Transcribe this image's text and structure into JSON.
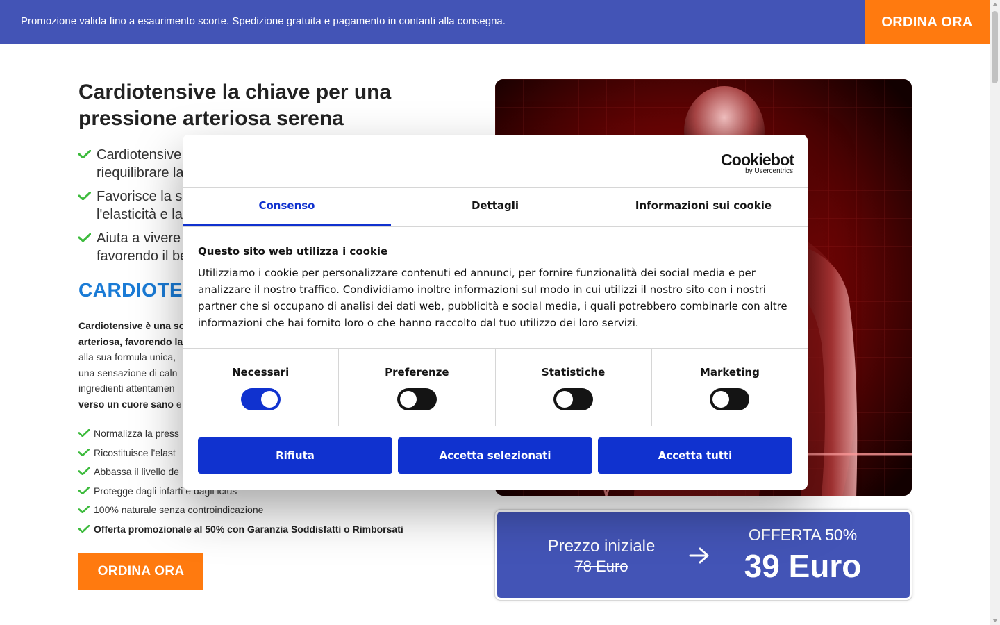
{
  "topbar": {
    "text": "Promozione valida fino a esaurimento scorte. Spedizione gratuita e pagamento in contanti alla consegna.",
    "cta": "ORDINA ORA"
  },
  "hero": {
    "title": "Cardiotensive la chiave per una pressione arteriosa serena",
    "bullets": [
      "Cardiotensive",
      "riequilibrare la",
      "Favorisce la sa",
      "l'elasticità e la",
      "Aiuta a vivere",
      "favorendo il be"
    ],
    "subheading": "CARDIOTEN",
    "desc": {
      "line1": "Cardiotensive è una so",
      "line2": "arteriosa, favorendo la",
      "line3": "alla sua formula unica,",
      "line4": "una sensazione di caln",
      "line5": "ingredienti attentamen",
      "line6_bold": "verso un cuore sano",
      "line6_rest": " e"
    },
    "features": [
      "Normalizza la press",
      "Ricostituisce l'elast",
      "Abbassa il livello de",
      "Protegge dagli infarti e dagli ictus",
      "100% naturale senza controindicazione",
      "Offerta promozionale al 50% con Garanzia Soddisfatti o Rimborsati"
    ],
    "cta": "ORDINA ORA"
  },
  "price": {
    "initial_label": "Prezzo iniziale",
    "old_price": "78 Euro",
    "offer_label": "OFFERTA 50%",
    "new_price": "39 Euro"
  },
  "cookie": {
    "logo": "Cookiebot",
    "logo_sub": "by Usercentrics",
    "tabs": [
      "Consenso",
      "Dettagli",
      "Informazioni sui cookie"
    ],
    "active_tab": 0,
    "heading": "Questo sito web utilizza i cookie",
    "body": "Utilizziamo i cookie per personalizzare contenuti ed annunci, per fornire funzionalità dei social media e per analizzare il nostro traffico. Condividiamo inoltre informazioni sul modo in cui utilizzi il nostro sito con i nostri partner che si occupano di analisi dei dati web, pubblicità e social media, i quali potrebbero combinarle con altre informazioni che hai fornito loro o che hanno raccolto dal tuo utilizzo dei loro servizi.",
    "toggles": [
      {
        "label": "Necessari",
        "on": true
      },
      {
        "label": "Preferenze",
        "on": false
      },
      {
        "label": "Statistiche",
        "on": false
      },
      {
        "label": "Marketing",
        "on": false
      }
    ],
    "buttons": {
      "reject": "Rifiuta",
      "accept_selected": "Accetta selezionati",
      "accept_all": "Accetta tutti"
    }
  },
  "colors": {
    "bar_blue": "#4354b6",
    "cta_orange": "#ff7a0f",
    "cookie_blue": "#1032cf",
    "heading_blue": "#1a7bd6",
    "check_green": "#3dbb3d"
  }
}
